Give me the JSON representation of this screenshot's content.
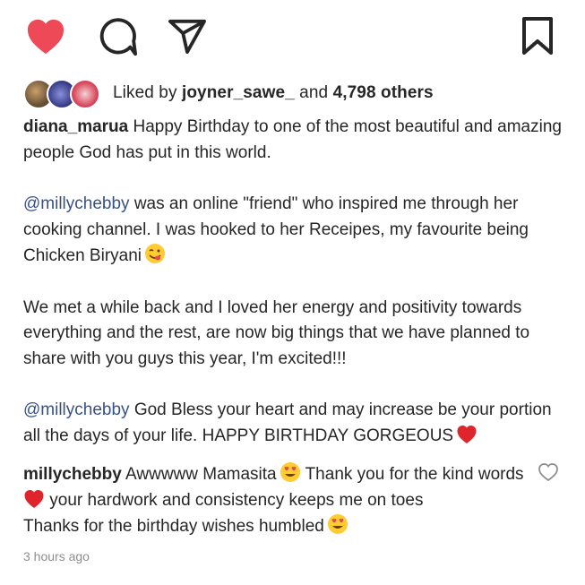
{
  "liked_by": {
    "prefix": "Liked by ",
    "user": "joyner_sawe_",
    "middle": " and ",
    "count": "4,798 others"
  },
  "caption": {
    "username": "diana_marua",
    "para1": " Happy Birthday to one of the most beautiful and amazing people God has put in this world.",
    "para2_mention": "@millychebby",
    "para2": " was an online \"friend\" who inspired me through her cooking channel. I was hooked to her Receipes, my favourite being Chicken Biryani",
    "para2_emoji": "yum-face",
    "para3": "We met a while back and I loved her energy and positivity towards everything and the rest, are now big things that we have planned to share with you guys this year, I'm excited!!!",
    "para4_mention": "@millychebby",
    "para4": " God Bless your heart and may increase be your portion all the days of your life. HAPPY BIRTHDAY GORGEOUS",
    "para4_emoji": "red-heart"
  },
  "reply": {
    "username": "millychebby",
    "part1": " Awwwww Mamasita",
    "part2": " Thank you for the kind words",
    "part3": " your hardwork and consistency keeps me on toes",
    "part4": "Thanks for the birthday wishes humbled",
    "emoji1": "heart-eyes",
    "emoji2": "red-heart",
    "emoji3": "heart-eyes"
  },
  "timestamp": "3 hours ago",
  "icons": {
    "like": "heart-icon-filled",
    "comment": "comment-icon",
    "share": "send-icon",
    "save": "bookmark-icon",
    "reply_like": "heart-outline-icon"
  },
  "colors": {
    "like": "#ed4956",
    "mention": "#385185",
    "text": "#262626",
    "muted": "#8e8e8e"
  }
}
